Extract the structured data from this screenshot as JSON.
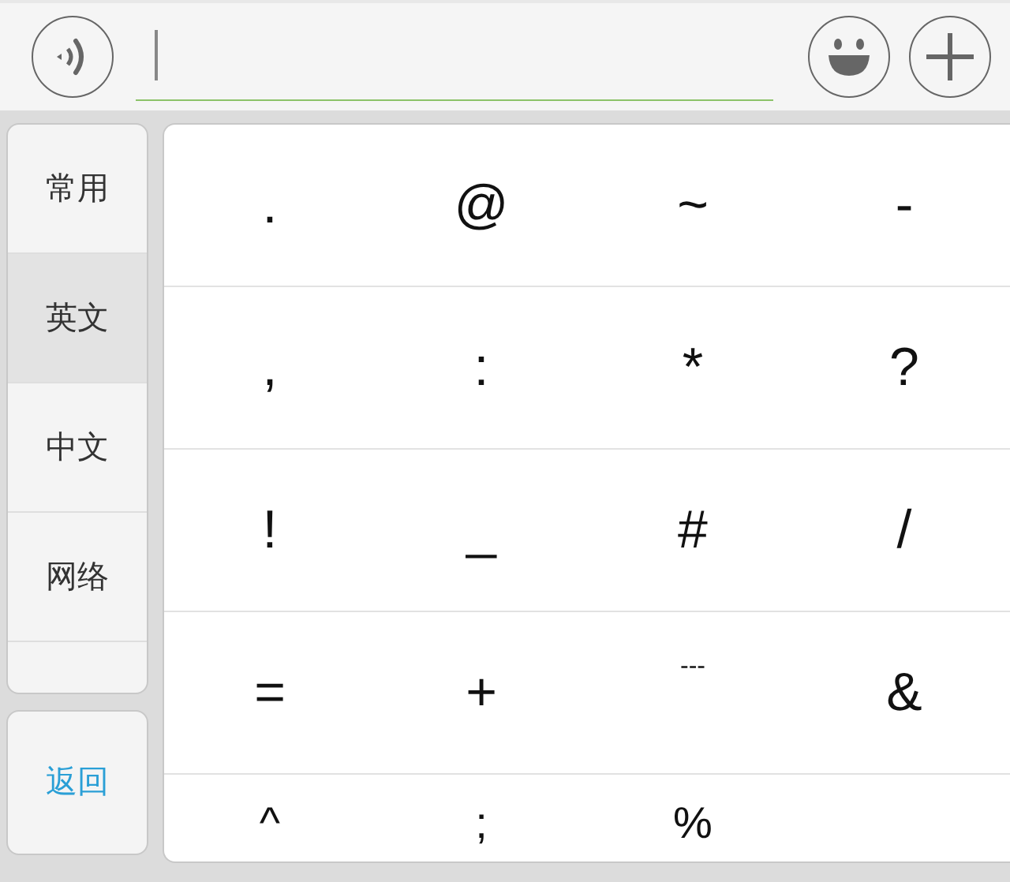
{
  "categories": [
    {
      "label": "常用",
      "selected": false
    },
    {
      "label": "英文",
      "selected": true
    },
    {
      "label": "中文",
      "selected": false
    },
    {
      "label": "网络",
      "selected": false
    }
  ],
  "back_button": {
    "label": "返回"
  },
  "keys": [
    [
      ".",
      "@",
      "~",
      "-"
    ],
    [
      ",",
      ":",
      "*",
      "?"
    ],
    [
      "!",
      "_",
      "#",
      "/"
    ],
    [
      "=",
      "+",
      "---",
      "&"
    ],
    [
      "^",
      ";",
      "%"
    ]
  ]
}
